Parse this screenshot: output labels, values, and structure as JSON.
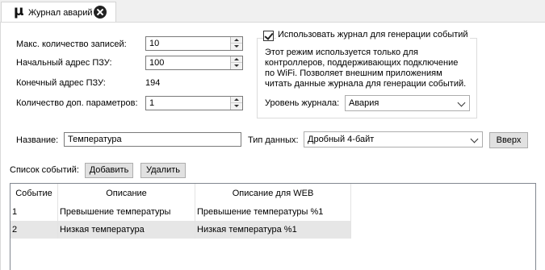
{
  "tab": {
    "logo": "μ",
    "title": "Журнал аварий",
    "close_icon": "close-circle-icon"
  },
  "settings": {
    "max_records": {
      "label": "Макс. количество записей:",
      "value": "10"
    },
    "start_address": {
      "label": "Начальный адрес ПЗУ:",
      "value": "100"
    },
    "end_address": {
      "label": "Конечный адрес ПЗУ:",
      "value": "194"
    },
    "extra_params": {
      "label": "Количество доп. параметров:",
      "value": "1"
    }
  },
  "event_gen": {
    "checkbox_label": "Использовать журнал для генерации событий",
    "checked": true,
    "description": "Этот режим используется только для контроллеров, поддерживающих подключение по WiFi. Позволяет внешним приложениям читать данные журнала для генерации событий.",
    "level_label": "Уровень журнала:",
    "level_value": "Авария"
  },
  "param": {
    "name_label": "Название:",
    "name_value": "Температура",
    "type_label": "Тип данных:",
    "type_value": "Дробный 4-байт",
    "up_button": "Вверх"
  },
  "events": {
    "list_label": "Список событий:",
    "add_button": "Добавить",
    "delete_button": "Удалить",
    "columns": [
      "Событие",
      "Описание",
      "Описание для WEB"
    ],
    "rows": [
      {
        "id": "1",
        "desc": "Превышение температуры",
        "web": "Превышение температуры %1"
      },
      {
        "id": "2",
        "desc": "Низкая температура",
        "web": "Низкая температура %1"
      }
    ]
  }
}
